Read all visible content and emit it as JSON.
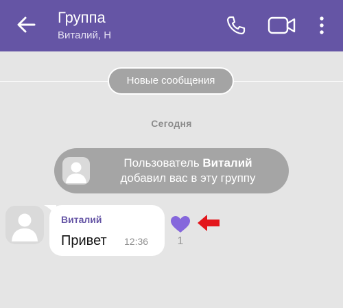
{
  "header": {
    "title": "Группа",
    "subtitle": "Виталий, Н",
    "icons": [
      "back-arrow-icon",
      "phone-icon",
      "video-camera-icon",
      "more-vertical-icon"
    ],
    "accent_color": "#6555a5"
  },
  "chat": {
    "new_messages_label": "Новые сообщения",
    "date_label": "Сегодня",
    "system_message": {
      "prefix": "Пользователь ",
      "name": "Виталий",
      "line2": "добавил вас в эту группу"
    },
    "message": {
      "sender": "Виталий",
      "text": "Привет",
      "time": "12:36",
      "likes": "1"
    },
    "annotation_color": "#e3161c"
  }
}
